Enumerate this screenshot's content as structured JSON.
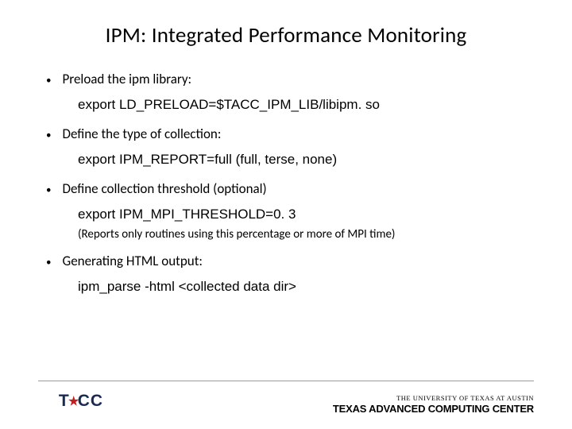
{
  "title": "IPM: Integrated Performance Monitoring",
  "bullets": [
    {
      "text": "Preload the ipm library:",
      "sub": "export LD_PRELOAD=$TACC_IPM_LIB/libipm. so"
    },
    {
      "text": "Define the type of collection:",
      "sub": "export IPM_REPORT=full  (full, terse, none)"
    },
    {
      "text": "Define collection threshold (optional)",
      "sub": "export IPM_MPI_THRESHOLD=0. 3",
      "sub2": "(Reports only routines using this percentage or more of MPI time)"
    },
    {
      "text": "Generating HTML output:",
      "sub": "ipm_parse -html <collected data dir>"
    }
  ],
  "footer": {
    "left_logo_text": "TACC",
    "right_line1": "THE UNIVERSITY OF TEXAS AT AUSTIN",
    "right_line2": "TEXAS ADVANCED COMPUTING CENTER"
  }
}
